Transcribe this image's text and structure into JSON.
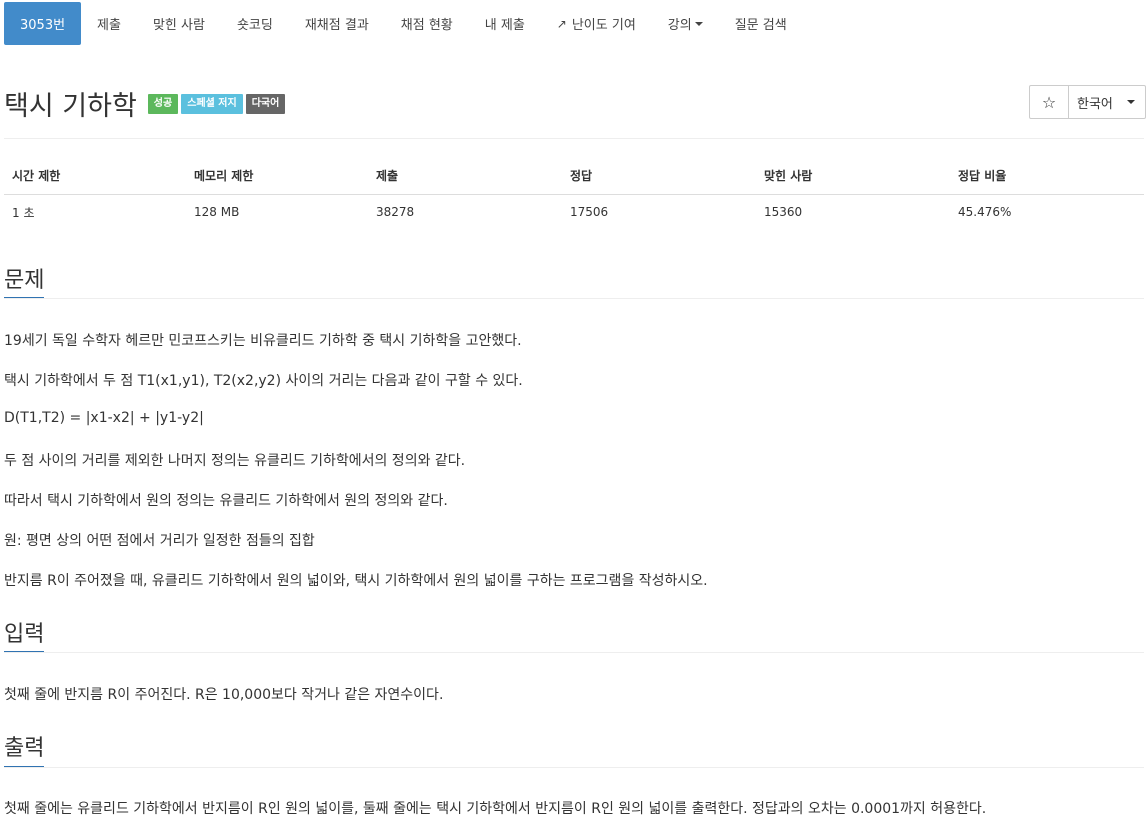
{
  "nav": {
    "tabs": [
      {
        "label": "3053번",
        "active": true
      },
      {
        "label": "제출"
      },
      {
        "label": "맞힌 사람"
      },
      {
        "label": "숏코딩"
      },
      {
        "label": "재채점 결과"
      },
      {
        "label": "채점 현황"
      },
      {
        "label": "내 제출"
      },
      {
        "label": "난이도 기여",
        "icon": "external-link-icon"
      },
      {
        "label": "강의",
        "dropdown": true
      },
      {
        "label": "질문 검색"
      }
    ]
  },
  "problem": {
    "title": "택시 기하학",
    "labels": {
      "success": "성공",
      "special_judge": "스페셜 저지",
      "multilang": "다국어"
    },
    "star_icon": "☆",
    "language": "한국어"
  },
  "info_table": {
    "headers": [
      "시간 제한",
      "메모리 제한",
      "제출",
      "정답",
      "맞힌 사람",
      "정답 비율"
    ],
    "values": [
      "1 초",
      "128 MB",
      "38278",
      "17506",
      "15360",
      "45.476%"
    ]
  },
  "sections": {
    "problem": {
      "heading": "문제",
      "paragraphs": [
        "19세기 독일 수학자 헤르만 민코프스키는 비유클리드 기하학 중 택시 기하학을 고안했다.",
        "택시 기하학에서 두 점 T1(x1,y1), T2(x2,y2) 사이의 거리는 다음과 같이 구할 수 있다.",
        "D(T1,T2) = |x1-x2| + |y1-y2|",
        "두 점 사이의 거리를 제외한 나머지 정의는 유클리드 기하학에서의 정의와 같다.",
        "따라서 택시 기하학에서 원의 정의는 유클리드 기하학에서 원의 정의와 같다.",
        "원: 평면 상의 어떤 점에서 거리가 일정한 점들의 집합",
        "반지름 R이 주어졌을 때, 유클리드 기하학에서 원의 넓이와, 택시 기하학에서 원의 넓이를 구하는 프로그램을 작성하시오."
      ]
    },
    "input": {
      "heading": "입력",
      "paragraphs": [
        "첫째 줄에 반지름 R이 주어진다. R은 10,000보다 작거나 같은 자연수이다."
      ]
    },
    "output": {
      "heading": "출력",
      "paragraphs": [
        "첫째 줄에는 유클리드 기하학에서 반지름이 R인 원의 넓이를, 둘째 줄에는 택시 기하학에서 반지름이 R인 원의 넓이를 출력한다. 정답과의 오차는 0.0001까지 허용한다."
      ]
    }
  },
  "colors": {
    "active_tab": "#428bca",
    "success": "#5cb85c",
    "special_judge": "#5bc0de",
    "multilang": "#666666",
    "section_underline": "#3073b2"
  }
}
